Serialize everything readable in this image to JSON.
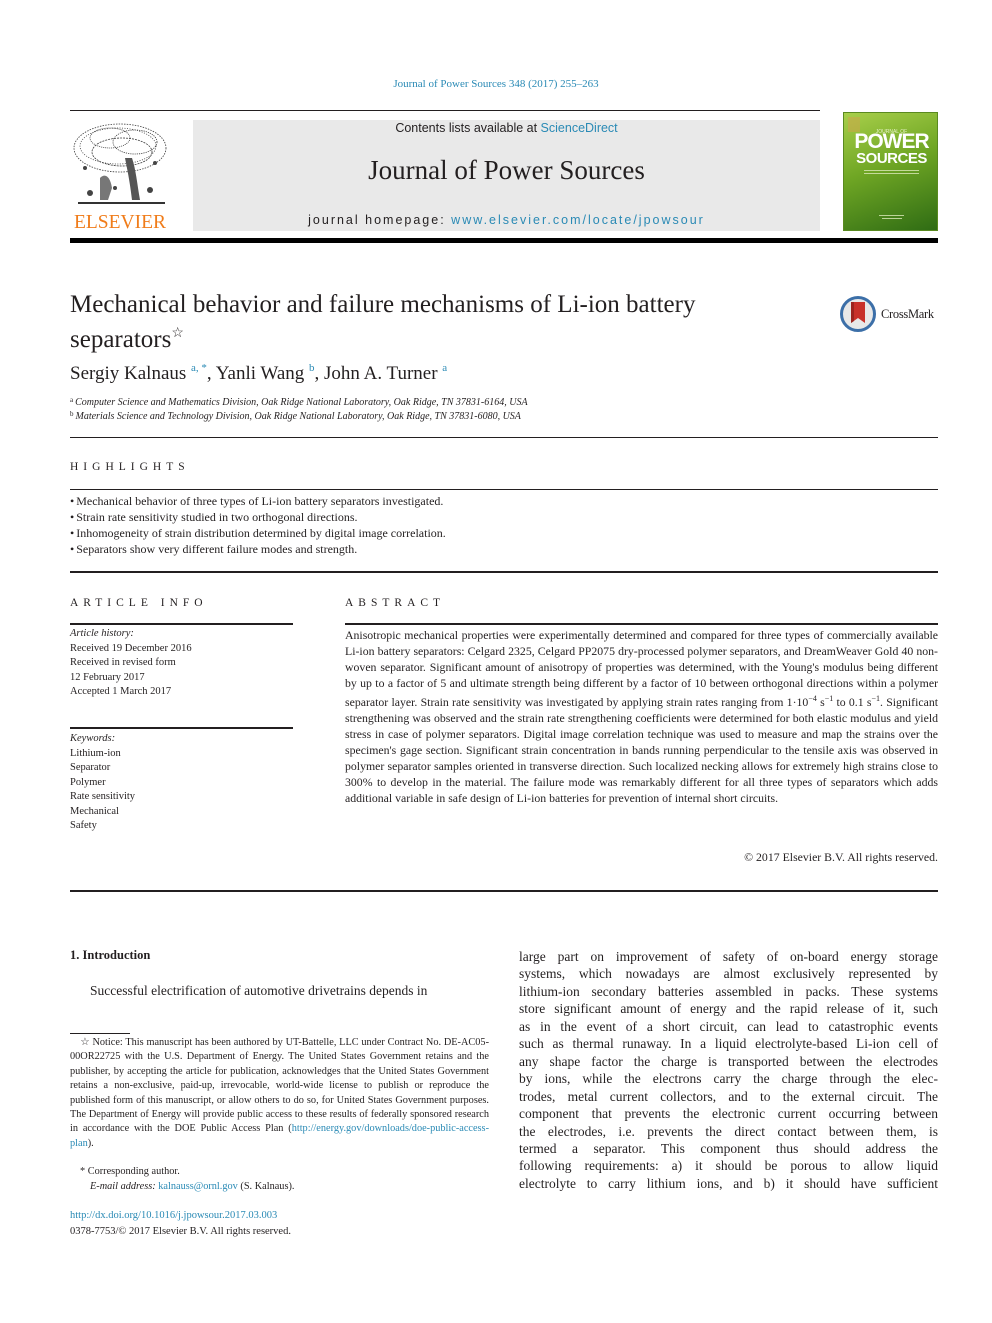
{
  "header": {
    "journal_reference": "Journal of Power Sources 348 (2017) 255–263",
    "contents_prefix": "Contents lists available at ",
    "contents_link": "ScienceDirect",
    "journal_title": "Journal of Power Sources",
    "homepage_prefix": "journal homepage: ",
    "homepage_link": "www.elsevier.com/locate/jpowsour",
    "publisher_logo_text": "ELSEVIER",
    "cover": {
      "journal_small": "JOURNAL OF",
      "power": "POWER",
      "sources": "SOURCES"
    },
    "colors": {
      "link": "#2a8ab5",
      "elsevier_orange": "#f07c1a",
      "cover_green": "#6fa624",
      "header_band": "#e9e9e9"
    }
  },
  "article": {
    "title_line1": "Mechanical behavior and failure mechanisms of Li-ion battery",
    "title_line2": "separators",
    "title_note_marker": "☆",
    "crossmark_label": "CrossMark",
    "authors": [
      {
        "name": "Sergiy Kalnaus",
        "affil": "a, *"
      },
      {
        "name": "Yanli Wang",
        "affil": "b"
      },
      {
        "name": "John A. Turner",
        "affil": "a"
      }
    ],
    "affiliations": [
      {
        "marker": "a",
        "text": "Computer Science and Mathematics Division, Oak Ridge National Laboratory, Oak Ridge, TN 37831-6164, USA"
      },
      {
        "marker": "b",
        "text": "Materials Science and Technology Division, Oak Ridge National Laboratory, Oak Ridge, TN 37831-6080, USA"
      }
    ]
  },
  "highlights": {
    "heading": "HIGHLIGHTS",
    "items": [
      "Mechanical behavior of three types of Li-ion battery separators investigated.",
      "Strain rate sensitivity studied in two orthogonal directions.",
      "Inhomogeneity of strain distribution determined by digital image correlation.",
      "Separators show very different failure modes and strength."
    ]
  },
  "article_info": {
    "heading": "ARTICLE INFO",
    "history_label": "Article history:",
    "history": [
      "Received 19 December 2016",
      "Received in revised form",
      "12 February 2017",
      "Accepted 1 March 2017"
    ],
    "keywords_label": "Keywords:",
    "keywords": [
      "Lithium-ion",
      "Separator",
      "Polymer",
      "Rate sensitivity",
      "Mechanical",
      "Safety"
    ]
  },
  "abstract": {
    "heading": "ABSTRACT",
    "text_part1": "Anisotropic mechanical properties were experimentally determined and compared for three types of commercially available Li-ion battery separators: Celgard 2325, Celgard PP2075 dry-processed polymer separators, and DreamWeaver Gold 40 non-woven separator. Significant amount of anisotropy of properties was determined, with the Young's modulus being different by up to a factor of 5 and ultimate strength being different by a factor of 10 between orthogonal directions within a polymer separator layer. Strain rate sensitivity was investigated by applying strain rates ranging from 1·10",
    "exp1": "−4",
    "unit1": " s",
    "exp2": "−1",
    "text_part2": " to 0.1 s",
    "exp3": "−1",
    "text_part3": ". Significant strengthening was observed and the strain rate strengthening coefficients were determined for both elastic modulus and yield stress in case of polymer separators. Digital image correlation technique was used to measure and map the strains over the specimen's gage section. Significant strain concentration in bands running perpendicular to the tensile axis was observed in polymer separator samples oriented in transverse direction. Such localized necking allows for extremely high strains close to 300% to develop in the material. The failure mode was remarkably different for all three types of separators which adds additional variable in safe design of Li-ion batteries for prevention of internal short circuits.",
    "copyright": "© 2017 Elsevier B.V. All rights reserved."
  },
  "introduction": {
    "heading": "1.  Introduction",
    "left_paragraph": "Successful electrification of automotive drivetrains depends in",
    "right_lines": [
      "large part on improvement of safety of on-board energy storage",
      "systems, which nowadays are almost exclusively represented by",
      "lithium-ion secondary batteries assembled in packs. These systems",
      "store significant amount of energy and the rapid release of it, such",
      "as in the event of a short circuit, can lead to catastrophic events",
      "such as thermal runaway. In a liquid electrolyte-based Li-ion cell of",
      "any shape factor the charge is transported between the electrodes",
      "by ions, while the electrons carry the charge through the elec-",
      "trodes, metal current collectors, and to the external circuit. The",
      "component that prevents the electronic current occurring between",
      "the electrodes, i.e. prevents the direct contact between them, is",
      "termed a separator. This component thus should address the",
      "following requirements: a) it should be porous to allow liquid",
      "electrolyte to carry lithium ions, and b) it should have sufficient"
    ]
  },
  "footnotes": {
    "notice_marker": "☆",
    "notice_text": "Notice: This manuscript has been authored by UT-Battelle, LLC under Contract No. DE-AC05-00OR22725 with the U.S. Department of Energy. The United States Government retains and the publisher, by accepting the article for publication, acknowledges that the United States Government retains a non-exclusive, paid-up, irrevocable, world-wide license to publish or reproduce the published form of this manuscript, or allow others to do so, for United States Government purposes. The Department of Energy will provide public access to these results of federally sponsored research in accordance with the DOE Public Access Plan (",
    "notice_link": "http://energy.gov/downloads/doe-public-access-plan",
    "notice_end": ").",
    "corresponding_marker": "*",
    "corresponding_text": "Corresponding author.",
    "email_label": "E-mail address:",
    "email": "kalnauss@ornl.gov",
    "email_suffix": " (S. Kalnaus).",
    "doi": "http://dx.doi.org/10.1016/j.jpowsour.2017.03.003",
    "issn": "0378-7753/© 2017 Elsevier B.V. All rights reserved."
  }
}
